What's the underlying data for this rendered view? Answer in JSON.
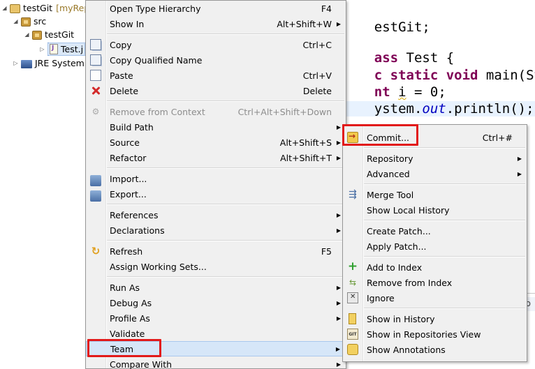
{
  "tree": {
    "project": "testGit",
    "project_decoration": "[myRep",
    "src": "src",
    "package": "testGit",
    "file": "Test.j",
    "jre": "JRE System"
  },
  "editor": {
    "lines": {
      "l1": {
        "rest": "estGit;"
      },
      "l2": {
        "kw": "ass",
        "rest": " Test {"
      },
      "l3": {
        "kw": "c static void",
        "rest": " main(Stri"
      },
      "l4": {
        "kw": "nt",
        "var": "i",
        "rest": " = 0;"
      },
      "l5": {
        "pre": "ystem.",
        "fld": "out",
        "rest": ".println();"
      }
    }
  },
  "context_menu": {
    "items": [
      {
        "label": "Open Type Hierarchy",
        "accel": "F4"
      },
      {
        "label": "Show In",
        "accel": "Alt+Shift+W"
      },
      {
        "label": "Copy",
        "accel": "Ctrl+C"
      },
      {
        "label": "Copy Qualified Name",
        "accel": ""
      },
      {
        "label": "Paste",
        "accel": "Ctrl+V"
      },
      {
        "label": "Delete",
        "accel": "Delete"
      },
      {
        "label": "Remove from Context",
        "accel": "Ctrl+Alt+Shift+Down"
      },
      {
        "label": "Build Path",
        "accel": ""
      },
      {
        "label": "Source",
        "accel": "Alt+Shift+S"
      },
      {
        "label": "Refactor",
        "accel": "Alt+Shift+T"
      },
      {
        "label": "Import...",
        "accel": ""
      },
      {
        "label": "Export...",
        "accel": ""
      },
      {
        "label": "References",
        "accel": ""
      },
      {
        "label": "Declarations",
        "accel": ""
      },
      {
        "label": "Refresh",
        "accel": "F5"
      },
      {
        "label": "Assign Working Sets...",
        "accel": ""
      },
      {
        "label": "Run As",
        "accel": ""
      },
      {
        "label": "Debug As",
        "accel": ""
      },
      {
        "label": "Profile As",
        "accel": ""
      },
      {
        "label": "Validate",
        "accel": ""
      },
      {
        "label": "Team",
        "accel": ""
      },
      {
        "label": "Compare With",
        "accel": ""
      }
    ]
  },
  "team_menu": {
    "items": [
      {
        "label": "Commit...",
        "accel": "Ctrl+#"
      },
      {
        "label": "Repository"
      },
      {
        "label": "Advanced"
      },
      {
        "label": "Merge Tool"
      },
      {
        "label": "Show Local History"
      },
      {
        "label": "Create Patch..."
      },
      {
        "label": "Apply Patch..."
      },
      {
        "label": "Add to Index"
      },
      {
        "label": "Remove from Index"
      },
      {
        "label": "Ignore"
      },
      {
        "label": "Show in History"
      },
      {
        "label": "Show in Repositories View"
      },
      {
        "label": "Show Annotations"
      }
    ]
  },
  "icons": {
    "git_badge": "GIT"
  },
  "colors": {
    "highlight_box": "#e21a1a",
    "keyword": "#7f0055",
    "field": "#0000c0",
    "menu_bg": "#f0f0f0"
  }
}
